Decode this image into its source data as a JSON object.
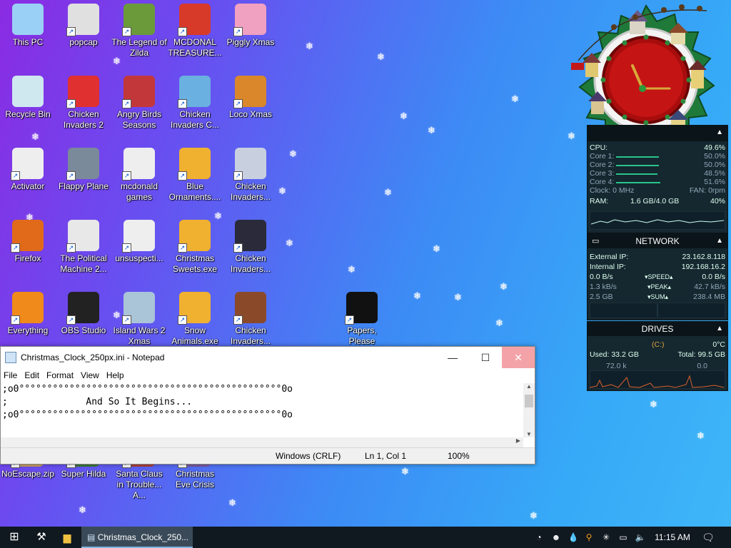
{
  "desktop_icons": [
    {
      "label": "This PC",
      "x": 0
    },
    {
      "label": "popcap"
    },
    {
      "label": "The Legend of Zilda"
    },
    {
      "label": "MCDONAL TREASURE..."
    },
    {
      "label": "Piggly Xmas"
    },
    {
      "label": "Recycle Bin"
    },
    {
      "label": "Chicken Invaders 2"
    },
    {
      "label": "Angry Birds Seasons"
    },
    {
      "label": "Chicken Invaders C..."
    },
    {
      "label": "Loco Xmas"
    },
    {
      "label": "Activator"
    },
    {
      "label": "Flappy Plane"
    },
    {
      "label": "mcdonald games"
    },
    {
      "label": "Blue Ornaments...."
    },
    {
      "label": "Chicken Invaders..."
    },
    {
      "label": "Firefox"
    },
    {
      "label": "The Political Machine 2..."
    },
    {
      "label": "unsuspecti..."
    },
    {
      "label": "Christmas Sweets.exe"
    },
    {
      "label": "Chicken Invaders..."
    },
    {
      "label": "Everything"
    },
    {
      "label": "OBS Studio"
    },
    {
      "label": "Island Wars 2 Xmas"
    },
    {
      "label": "Snow Animals.exe"
    },
    {
      "label": "Chicken Invaders..."
    },
    {
      "label": "Papers, Please"
    },
    {
      "label": "NoEscape.zip"
    },
    {
      "label": "Super Hilda"
    },
    {
      "label": "Santa Claus in Trouble... A..."
    },
    {
      "label": "Christmas Eve Crisis"
    }
  ],
  "notepad": {
    "title": "Christmas_Clock_250px.ini - Notepad",
    "menu": [
      "File",
      "Edit",
      "Format",
      "View",
      "Help"
    ],
    "lines": [
      ";o0°°°°°°°°°°°°°°°°°°°°°°°°°°°°°°°°°°°°°°°°°°°°°°°0o",
      ";              And So It Begins...",
      ";o0°°°°°°°°°°°°°°°°°°°°°°°°°°°°°°°°°°°°°°°°°°°°°°°0o"
    ],
    "status": {
      "line_ending": "Windows (CRLF)",
      "position": "Ln 1, Col 1",
      "zoom": "100%"
    }
  },
  "cpu_gadget": {
    "cpu_label": "CPU:",
    "cpu_value": "49.6%",
    "cores": [
      {
        "label": "Core 1:",
        "value": "50.0%"
      },
      {
        "label": "Core 2:",
        "value": "50.0%"
      },
      {
        "label": "Core 3:",
        "value": "48.5%"
      },
      {
        "label": "Core 4:",
        "value": "51.6%"
      }
    ],
    "clock": "Clock: 0 MHz",
    "fan": "FAN: 0rpm",
    "ram_label": "RAM:",
    "ram_value": "1.6 GB/4.0 GB",
    "ram_pct": "40%"
  },
  "network_gadget": {
    "title": "NETWORK",
    "external_label": "External IP:",
    "external_ip": "23.162.8.118",
    "internal_label": "Internal IP:",
    "internal_ip": "192.168.16.2",
    "speed_left": "0.0 B/s",
    "speed_label": "SPEED",
    "speed_right": "0.0 B/s",
    "peak_left": "1.3 kB/s",
    "peak_label": "PEAK",
    "peak_right": "42.7 kB/s",
    "sum_left": "2.5 GB",
    "sum_label": "SUM",
    "sum_right": "238.4 MB"
  },
  "drives_gadget": {
    "title": "DRIVES",
    "drive": "(C:)",
    "temp": "0°C",
    "used": "Used: 33.2 GB",
    "total": "Total: 99.5 GB",
    "read": "72.0 k",
    "write": "0.0"
  },
  "taskbar": {
    "window_button": "Christmas_Clock_250...",
    "time": "11:15 AM"
  },
  "colors": {
    "accent_close": "#e81123",
    "gadget_bg": "#15272f",
    "graph_orange": "#d9622b",
    "graph_green": "#2ac48a"
  }
}
